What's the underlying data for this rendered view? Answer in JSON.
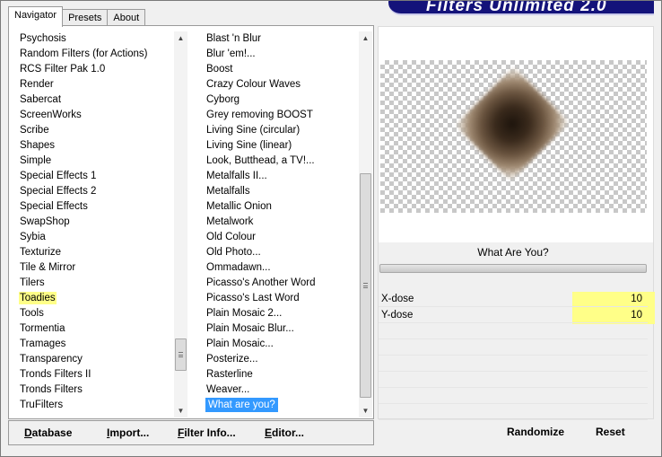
{
  "tabs": [
    "Navigator",
    "Presets",
    "About"
  ],
  "banner": {
    "title": "Filters Unlimited 2.0"
  },
  "categories": [
    "Psychosis",
    "Random Filters (for Actions)",
    "RCS Filter Pak 1.0",
    "Render",
    "Sabercat",
    "ScreenWorks",
    "Scribe",
    "Shapes",
    "Simple",
    "Special Effects 1",
    "Special Effects 2",
    "Special Effects",
    "SwapShop",
    "Sybia",
    "Texturize",
    "Tile & Mirror",
    "Tilers",
    "Toadies",
    "Tools",
    "Tormentia",
    "Tramages",
    "Transparency",
    "Tronds Filters II",
    "Tronds Filters",
    "TruFilters"
  ],
  "highlighted_category": "Toadies",
  "filters": [
    "Blast 'n Blur",
    "Blur 'em!...",
    "Boost",
    "Crazy Colour Waves",
    "Cyborg",
    "Grey removing BOOST",
    "Living Sine (circular)",
    "Living Sine (linear)",
    "Look, Butthead, a TV!...",
    "Metalfalls II...",
    "Metalfalls",
    "Metallic Onion",
    "Metalwork",
    "Old Colour",
    "Old Photo...",
    "Ommadawn...",
    "Picasso's Another Word",
    "Picasso's Last Word",
    "Plain Mosaic 2...",
    "Plain Mosaic Blur...",
    "Plain Mosaic...",
    "Posterize...",
    "Rasterline",
    "Weaver...",
    "What are you?"
  ],
  "selected_filter": "What are you?",
  "left_buttons": {
    "database": "Database",
    "import": "Import...",
    "filter_info": "Filter Info...",
    "editor": "Editor..."
  },
  "filter_title": "What Are You?",
  "params": [
    {
      "name": "X-dose",
      "value": "10"
    },
    {
      "name": "Y-dose",
      "value": "10"
    }
  ],
  "right_buttons": {
    "randomize": "Randomize",
    "reset": "Reset"
  },
  "scroll": {
    "categories_position": 0.86,
    "filters_position": 0.55
  },
  "colors": {
    "highlight": "#ffff88",
    "selection": "#3399ff",
    "banner": "#14137a"
  }
}
